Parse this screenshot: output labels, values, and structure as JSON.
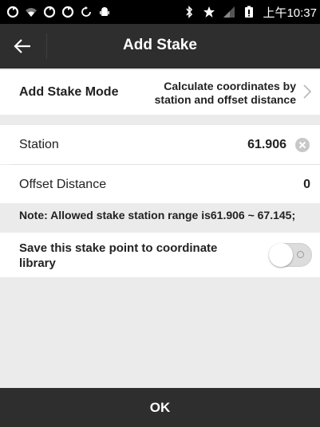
{
  "status_bar": {
    "time": "上午10:37",
    "icons_left": [
      "sync-icon",
      "wifi-icon",
      "sync-icon",
      "sync-icon",
      "refresh-icon",
      "android-icon"
    ],
    "icons_right": [
      "bluetooth-icon",
      "star-icon",
      "signal-icon",
      "battery-icon"
    ]
  },
  "header": {
    "title": "Add Stake"
  },
  "mode": {
    "label": "Add Stake Mode",
    "value_line1": "Calculate coordinates by",
    "value_line2": "station and offset distance"
  },
  "station": {
    "label": "Station",
    "value": "61.906"
  },
  "offset": {
    "label": "Offset Distance",
    "value": "0"
  },
  "note": "Note: Allowed stake station range is61.906 ~ 67.145;",
  "save_option": {
    "label_line1": "Save this stake point to coordinate",
    "label_line2": "library",
    "enabled": false
  },
  "footer": {
    "ok_label": "OK"
  },
  "colors": {
    "bar": "#2e2e2e",
    "background": "#ebebeb",
    "row": "#ffffff"
  }
}
